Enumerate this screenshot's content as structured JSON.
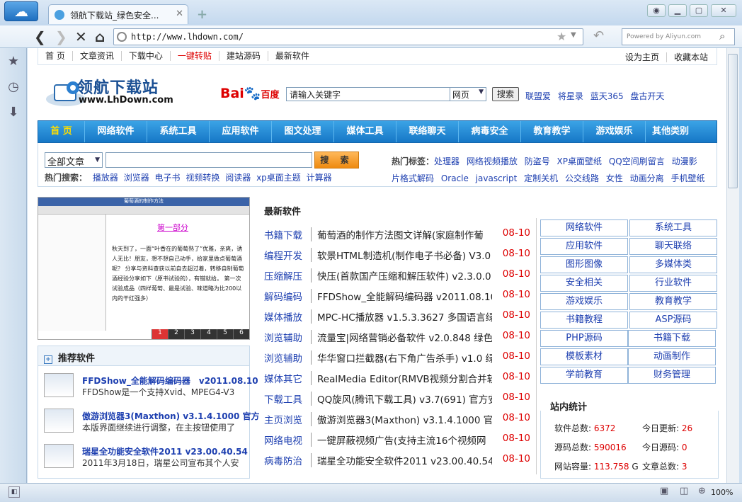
{
  "browser": {
    "tab_title": "领航下载站_绿色安全...",
    "tab_close": "✕",
    "new_tab": "+",
    "url": "http://www.lhdown.com/",
    "search_placeholder": "Powered by Aliyun.com",
    "zoom": "100%"
  },
  "topnav": {
    "items": [
      "首 页",
      "文章资讯",
      "下载中心",
      "一键转贴",
      "建站源码",
      "最新软件"
    ],
    "right": [
      "设为主页",
      "收藏本站"
    ]
  },
  "logo": {
    "name": "领航下载站",
    "url_text": "www.LhDown.com"
  },
  "baidu": {
    "logo_a": "Bai",
    "logo_b": "百度",
    "input": "请输入关键字",
    "select": "网页",
    "button": "搜索"
  },
  "partner_sites": [
    "联盟爱",
    "将星录",
    "蓝天365",
    "盘古开天"
  ],
  "mainnav": [
    "首 页",
    "网络软件",
    "系统工具",
    "应用软件",
    "图文处理",
    "媒体工具",
    "联络聊天",
    "病毒安全",
    "教育教学",
    "游戏娱乐",
    "其他类别"
  ],
  "search": {
    "category": "全部文章",
    "button": "搜 索",
    "hot_label": "热门搜索：",
    "hot_items": [
      "播放器",
      "浏览器",
      "电子书",
      "视频转换",
      "阅读器",
      "xp桌面主题",
      "计算器"
    ],
    "tags_label": "热门标签：",
    "tags": [
      "处理器",
      "网络视频播放",
      "防盗号",
      "XP桌面壁纸",
      "QQ空间刷留言",
      "动漫影",
      "片格式解码",
      "Oracle",
      "javascript",
      "定制关机",
      "公交线路",
      "女性",
      "动画分离",
      "手机壁纸"
    ]
  },
  "slide": {
    "title": "葡萄酒的制作方法",
    "doc_title": "第一部分",
    "doc_text": "秋天到了，一面“叶香在的葡萄熟了”优雅，亲爽，诱人无比！朋友，想不想自己动手，给家里做点葡萄酒呢？ 分享与资料查获以前自去超过着，转移自制葡萄酒经验分享如下（原书试验的），有错就给。 第一次试验成品（四样葡萄、最是试验、味道略为比200以内的干红强多）",
    "pages": [
      "1",
      "2",
      "3",
      "4",
      "5",
      "6"
    ]
  },
  "recommend": {
    "title": "推荐软件",
    "items": [
      {
        "title": "FFDShow_全能解码编码器　v2011.08.10",
        "desc": "FFDShow是一个支持Xvid、MPEG4-V3"
      },
      {
        "title": "傲游浏览器3(Maxthon) v3.1.4.1000 官方",
        "desc": "本版界面继续进行调整，在主按钮使用了"
      },
      {
        "title": "瑞星全功能安全软件2011 v23.00.40.54",
        "desc": "2011年3月18日，瑞星公司宣布其个人安"
      }
    ]
  },
  "latest": {
    "title": "最新软件",
    "rows": [
      {
        "cat": "书籍下载",
        "title": "葡萄酒的制作方法图文详解(家庭制作葡",
        "date": "08-10"
      },
      {
        "cat": "编程开发",
        "title": "软景HTML制造机(制作电子书必备) V3.0",
        "date": "08-10"
      },
      {
        "cat": "压缩解压",
        "title": "快压(首款国产压缩和解压软件) v2.3.0.0",
        "date": "08-10"
      },
      {
        "cat": "解码编码",
        "title": "FFDShow_全能解码编码器 v2011.08.10",
        "date": "08-10"
      },
      {
        "cat": "媒体播放",
        "title": "MPC-HC播放器 v1.5.3.3627 多国语言绿",
        "date": "08-10"
      },
      {
        "cat": "浏览辅助",
        "title": "流量宝|网络营销必备软件 v2.0.848 绿色",
        "date": "08-10"
      },
      {
        "cat": "浏览辅助",
        "title": "华华窗口拦截器(右下角广告杀手) v1.0 绿",
        "date": "08-10"
      },
      {
        "cat": "媒体其它",
        "title": "RealMedia Editor(RMVB视频分割合并软",
        "date": "08-10"
      },
      {
        "cat": "下载工具",
        "title": "QQ旋风(腾讯下载工具) v3.7(691) 官方安",
        "date": "08-10"
      },
      {
        "cat": "主页浏览",
        "title": "傲游浏览器3(Maxthon) v3.1.4.1000 官方",
        "date": "08-10"
      },
      {
        "cat": "网络电视",
        "title": "一键屏蔽视频广告(支持主流16个视频网",
        "date": "08-10"
      },
      {
        "cat": "病毒防治",
        "title": "瑞星全功能安全软件2011 v23.00.40.54",
        "date": "08-10"
      }
    ]
  },
  "categories": [
    "网络软件",
    "系统工具",
    "应用软件",
    "聊天联络",
    "图形图像",
    "多媒体类",
    "安全相关",
    "行业软件",
    "游戏娱乐",
    "教育教学",
    "书籍教程",
    "ASP源码",
    "PHP源码",
    "书籍下载",
    "模板素材",
    "动画制作",
    "学前教育",
    "财务管理"
  ],
  "stats": {
    "title": "站内统计",
    "items": [
      {
        "label": "软件总数:",
        "value": "6372"
      },
      {
        "label": "今日更新:",
        "value": "26"
      },
      {
        "label": "源码总数:",
        "value": "590016"
      },
      {
        "label": "今日源码:",
        "value": "0"
      },
      {
        "label": "网站容量:",
        "value": "113.758",
        "unit": "G"
      },
      {
        "label": "文章总数:",
        "value": "3"
      }
    ]
  }
}
